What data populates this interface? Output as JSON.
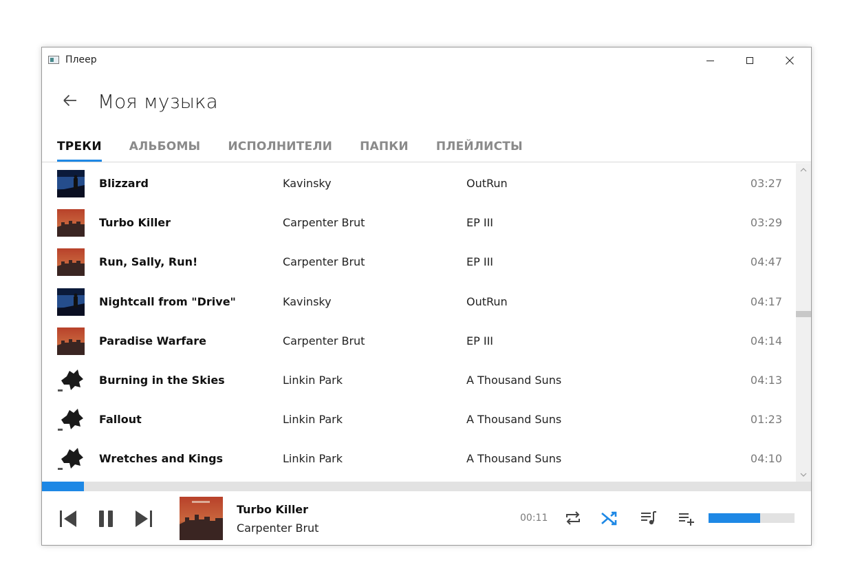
{
  "window": {
    "title": "Плеер"
  },
  "header": {
    "title": "Моя музыка"
  },
  "tabs": [
    {
      "label": "ТРЕКИ",
      "active": true
    },
    {
      "label": "АЛЬБОМЫ",
      "active": false
    },
    {
      "label": "ИСПОЛНИТЕЛИ",
      "active": false
    },
    {
      "label": "ПАПКИ",
      "active": false
    },
    {
      "label": "ПЛЕЙЛИСТЫ",
      "active": false
    }
  ],
  "tracks": [
    {
      "title": "Blizzard",
      "artist": "Kavinsky",
      "album": "OutRun",
      "duration": "03:27",
      "cover": "outrun"
    },
    {
      "title": "Turbo Killer",
      "artist": "Carpenter Brut",
      "album": "EP III",
      "duration": "03:29",
      "cover": "ep3"
    },
    {
      "title": "Run, Sally, Run!",
      "artist": "Carpenter Brut",
      "album": "EP III",
      "duration": "04:47",
      "cover": "ep3"
    },
    {
      "title": "Nightcall from \"Drive\"",
      "artist": "Kavinsky",
      "album": "OutRun",
      "duration": "04:17",
      "cover": "outrun"
    },
    {
      "title": "Paradise Warfare",
      "artist": "Carpenter Brut",
      "album": "EP III",
      "duration": "04:14",
      "cover": "ep3"
    },
    {
      "title": "Burning in the Skies",
      "artist": "Linkin Park",
      "album": "A Thousand Suns",
      "duration": "04:13",
      "cover": "suns"
    },
    {
      "title": "Fallout",
      "artist": "Linkin Park",
      "album": "A Thousand Suns",
      "duration": "01:23",
      "cover": "suns"
    },
    {
      "title": "Wretches and Kings",
      "artist": "Linkin Park",
      "album": "A Thousand Suns",
      "duration": "04:10",
      "cover": "suns"
    }
  ],
  "player": {
    "now_playing_title": "Turbo Killer",
    "now_playing_artist": "Carpenter Brut",
    "elapsed": "00:11",
    "progress": 0.055,
    "volume": 0.6,
    "shuffle_active": true,
    "icons": [
      "skip-previous-icon",
      "pause-icon",
      "skip-next-icon",
      "repeat-icon",
      "shuffle-icon",
      "queue-music-icon",
      "playlist-add-icon"
    ]
  },
  "colors": {
    "accent": "#1e88e5",
    "muted_text": "#7a7a7a",
    "track_bg": "#e2e2e2"
  }
}
